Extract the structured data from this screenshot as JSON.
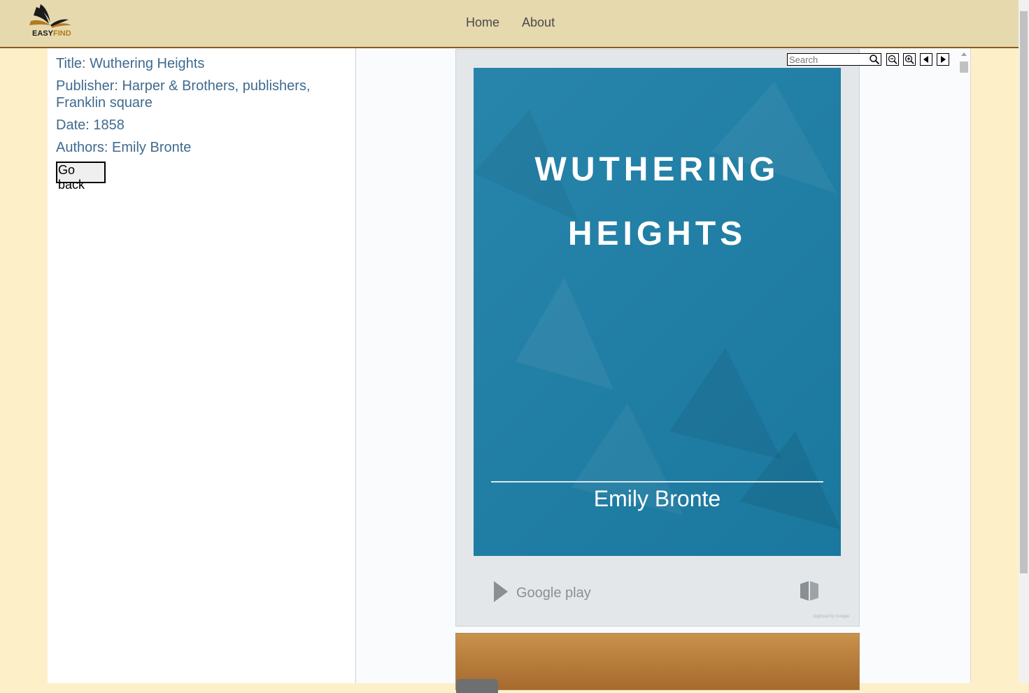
{
  "header": {
    "logo_part1": "EASY",
    "logo_part2": "FIND",
    "nav": {
      "home": "Home",
      "about": "About"
    }
  },
  "book": {
    "title_line": "Title: Wuthering Heights",
    "publisher_line": "Publisher: Harper & Brothers, publishers, Franklin square",
    "date_line": "Date: 1858",
    "authors_line": "Authors: Emily Bronte",
    "back_label": "Go back"
  },
  "viewer": {
    "search_placeholder": "Search",
    "cover_title_1": "WUTHERING",
    "cover_title_2": "HEIGHTS",
    "cover_author": "Emily Bronte",
    "store_label": "Google play",
    "digitized_note": "Digitized by Google"
  },
  "colors": {
    "header_bg": "#e6d9ae",
    "page_bg": "#fdf0c8",
    "meta_text": "#3f6a8e",
    "cover_blue": "#1c7ea6"
  },
  "icons": [
    "logo-icon",
    "search-icon",
    "zoom-out-icon",
    "zoom-in-icon",
    "prev-page-icon",
    "next-page-icon",
    "google-play-icon",
    "book-icon"
  ]
}
